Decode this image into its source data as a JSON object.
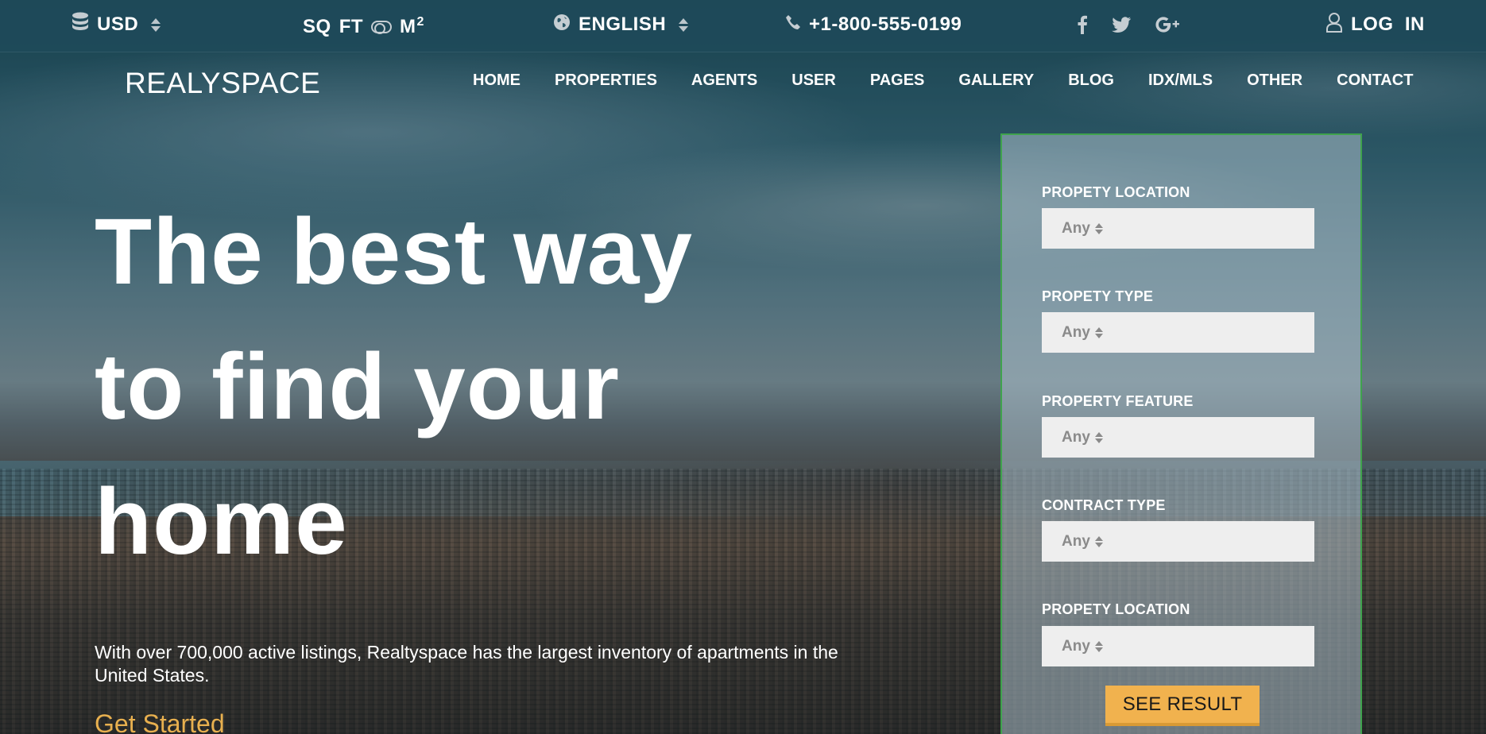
{
  "topbar": {
    "currency": "USD",
    "unit_sq": "SQ",
    "unit_ft": "FT",
    "unit_m": "M",
    "unit_m_sup": "2",
    "language": "ENGLISH",
    "phone": "+1-800-555-0199",
    "social": [
      "facebook-icon",
      "twitter-icon",
      "google-plus-icon"
    ],
    "login": "LOG  IN"
  },
  "nav": {
    "logo": "REALYSPACE",
    "items": [
      "HOME",
      "PROPERTIES",
      "AGENTS",
      "USER",
      "PAGES",
      "GALLERY",
      "BLOG",
      "IDX/MLS",
      "OTHER",
      "CONTACT"
    ]
  },
  "hero": {
    "title_lines": [
      "The best way",
      "to find your",
      "home"
    ],
    "description": "With over 700,000 active listings, Realtyspace has the largest inventory of apartments in the United States.",
    "cta": "Get Started"
  },
  "search": {
    "fields": [
      {
        "label": "PROPETY LOCATION",
        "value": "Any"
      },
      {
        "label": "PROPETY TYPE",
        "value": "Any"
      },
      {
        "label": "PROPERTY FEATURE",
        "value": "Any"
      },
      {
        "label": "CONTRACT TYPE",
        "value": "Any"
      },
      {
        "label": "PROPETY LOCATION",
        "value": "Any"
      }
    ],
    "button": "SEE RESULT"
  },
  "colors": {
    "accent": "#f1b24e",
    "cta_text": "#e8b04f",
    "topbar_bg": "#1f4a5a",
    "panel_border": "#3fa34d"
  }
}
